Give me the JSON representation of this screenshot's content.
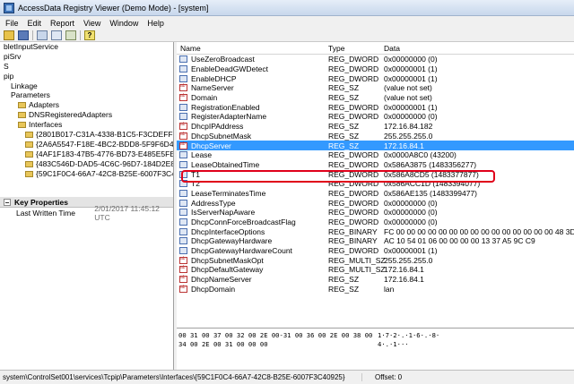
{
  "window": {
    "title": "AccessData Registry Viewer (Demo Mode) - [system]"
  },
  "menu": [
    "File",
    "Edit",
    "Report",
    "View",
    "Window",
    "Help"
  ],
  "tree": [
    {
      "label": "bletInputService",
      "indent": 0,
      "folder": false
    },
    {
      "label": "piSrv",
      "indent": 0,
      "folder": false
    },
    {
      "label": "S",
      "indent": 0,
      "folder": false
    },
    {
      "label": "pip",
      "indent": 0,
      "folder": false
    },
    {
      "label": "Linkage",
      "indent": 1,
      "folder": false
    },
    {
      "label": "Parameters",
      "indent": 1,
      "folder": false
    },
    {
      "label": "Adapters",
      "indent": 2,
      "folder": true
    },
    {
      "label": "DNSRegisteredAdapters",
      "indent": 2,
      "folder": true
    },
    {
      "label": "Interfaces",
      "indent": 2,
      "folder": true
    },
    {
      "label": "{2801B017-C31A-4338-B1C5-F3CDEFF094F8}",
      "indent": 3,
      "folder": true
    },
    {
      "label": "{2A6A5547-F18E-4BC2-BDD8-5F9F6D48503C}",
      "indent": 3,
      "folder": true
    },
    {
      "label": "{4AF1F183-47B5-4776-BD73-E485E5FE177C}",
      "indent": 3,
      "folder": true
    },
    {
      "label": "{483C546D-DAD5-4C6C-96D7-184D2E83257}",
      "indent": 3,
      "folder": true
    },
    {
      "label": "{59C1F0C4-66A7-42C8-B25E-6007F3C40925}",
      "indent": 3,
      "folder": true
    }
  ],
  "properties": {
    "header": "Key Properties",
    "label": "Last Written Time",
    "value": "2/01/2017  11:45:12 UTC"
  },
  "list": {
    "columns": [
      "Name",
      "Type",
      "Data"
    ],
    "rows": [
      {
        "name": "UseZeroBroadcast",
        "type": "REG_DWORD",
        "data": "0x00000000 (0)",
        "icon": "num"
      },
      {
        "name": "EnableDeadGWDetect",
        "type": "REG_DWORD",
        "data": "0x00000001 (1)",
        "icon": "num"
      },
      {
        "name": "EnableDHCP",
        "type": "REG_DWORD",
        "data": "0x00000001 (1)",
        "icon": "num"
      },
      {
        "name": "NameServer",
        "type": "REG_SZ",
        "data": "(value not set)",
        "icon": "str"
      },
      {
        "name": "Domain",
        "type": "REG_SZ",
        "data": "(value not set)",
        "icon": "str"
      },
      {
        "name": "RegistrationEnabled",
        "type": "REG_DWORD",
        "data": "0x00000001 (1)",
        "icon": "num"
      },
      {
        "name": "RegisterAdapterName",
        "type": "REG_DWORD",
        "data": "0x00000000 (0)",
        "icon": "num"
      },
      {
        "name": "DhcpIPAddress",
        "type": "REG_SZ",
        "data": "172.16.84.182",
        "icon": "str"
      },
      {
        "name": "DhcpSubnetMask",
        "type": "REG_SZ",
        "data": "255.255.255.0",
        "icon": "str"
      },
      {
        "name": "DhcpServer",
        "type": "REG_SZ",
        "data": "172.16.84.1",
        "icon": "str",
        "selected": true
      },
      {
        "name": "Lease",
        "type": "REG_DWORD",
        "data": "0x0000A8C0 (43200)",
        "icon": "num"
      },
      {
        "name": "LeaseObtainedTime",
        "type": "REG_DWORD",
        "data": "0x586A3875 (1483356277)",
        "icon": "num"
      },
      {
        "name": "T1",
        "type": "REG_DWORD",
        "data": "0x586A8CD5 (1483377877)",
        "icon": "num"
      },
      {
        "name": "T2",
        "type": "REG_DWORD",
        "data": "0x586ACC1D (1483394077)",
        "icon": "num"
      },
      {
        "name": "LeaseTerminatesTime",
        "type": "REG_DWORD",
        "data": "0x586AE135 (1483399477)",
        "icon": "num"
      },
      {
        "name": "AddressType",
        "type": "REG_DWORD",
        "data": "0x00000000 (0)",
        "icon": "num"
      },
      {
        "name": "IsServerNapAware",
        "type": "REG_DWORD",
        "data": "0x00000000 (0)",
        "icon": "num"
      },
      {
        "name": "DhcpConnForceBroadcastFlag",
        "type": "REG_DWORD",
        "data": "0x00000000 (0)",
        "icon": "num"
      },
      {
        "name": "DhcpInterfaceOptions",
        "type": "REG_BINARY",
        "data": "FC 00 00 00 00 00 00 00 00 00 00 00 00 00 00 00 48 3D ...",
        "icon": "num"
      },
      {
        "name": "DhcpGatewayHardware",
        "type": "REG_BINARY",
        "data": "AC 10 54 01 06 00 00 00 00 13 37 A5 9C C9",
        "icon": "num"
      },
      {
        "name": "DhcpGatewayHardwareCount",
        "type": "REG_DWORD",
        "data": "0x00000001 (1)",
        "icon": "num"
      },
      {
        "name": "DhcpSubnetMaskOpt",
        "type": "REG_MULTI_SZ",
        "data": "255.255.255.0",
        "icon": "str"
      },
      {
        "name": "DhcpDefaultGateway",
        "type": "REG_MULTI_SZ",
        "data": "172.16.84.1",
        "icon": "str"
      },
      {
        "name": "DhcpNameServer",
        "type": "REG_SZ",
        "data": "172.16.84.1",
        "icon": "str"
      },
      {
        "name": "DhcpDomain",
        "type": "REG_SZ",
        "data": "lan",
        "icon": "str"
      }
    ]
  },
  "hex": [
    {
      "bytes": "00 31 00 37 00 32 00 2E 00-31 00 36 00 2E 00 38 00",
      "ascii": "1·7·2·.·1·6·.·8·"
    },
    {
      "bytes": "34 00 2E 00 31 00 00 00",
      "ascii": "4·.·1···"
    }
  ],
  "status": {
    "path": "system\\ControlSet001\\services\\Tcpip\\Parameters\\Interfaces\\{59C1F0C4-66A7-42C8-B25E-6007F3C40925}",
    "offset": "Offset: 0"
  }
}
